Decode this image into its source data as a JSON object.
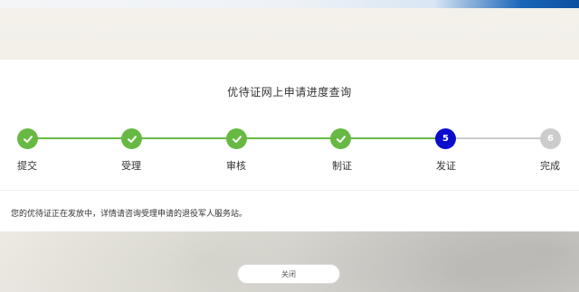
{
  "page": {
    "title": "优待证网上申请进度查询",
    "message": "您的优待证正在发放中，详情请咨询受理申请的退役军人服务站。",
    "close_label": "关闭"
  },
  "steps": [
    {
      "label": "提交",
      "status": "done",
      "icon": "check-icon"
    },
    {
      "label": "受理",
      "status": "done",
      "icon": "check-icon"
    },
    {
      "label": "审核",
      "status": "done",
      "icon": "check-icon"
    },
    {
      "label": "制证",
      "status": "done",
      "icon": "check-icon"
    },
    {
      "label": "发证",
      "status": "current",
      "number": "5"
    },
    {
      "label": "完成",
      "status": "pending",
      "number": "6"
    }
  ],
  "colors": {
    "done": "#68b944",
    "current": "#0c0ccc",
    "pending": "#cccccc",
    "brand_blue": "#0d4fa0"
  }
}
